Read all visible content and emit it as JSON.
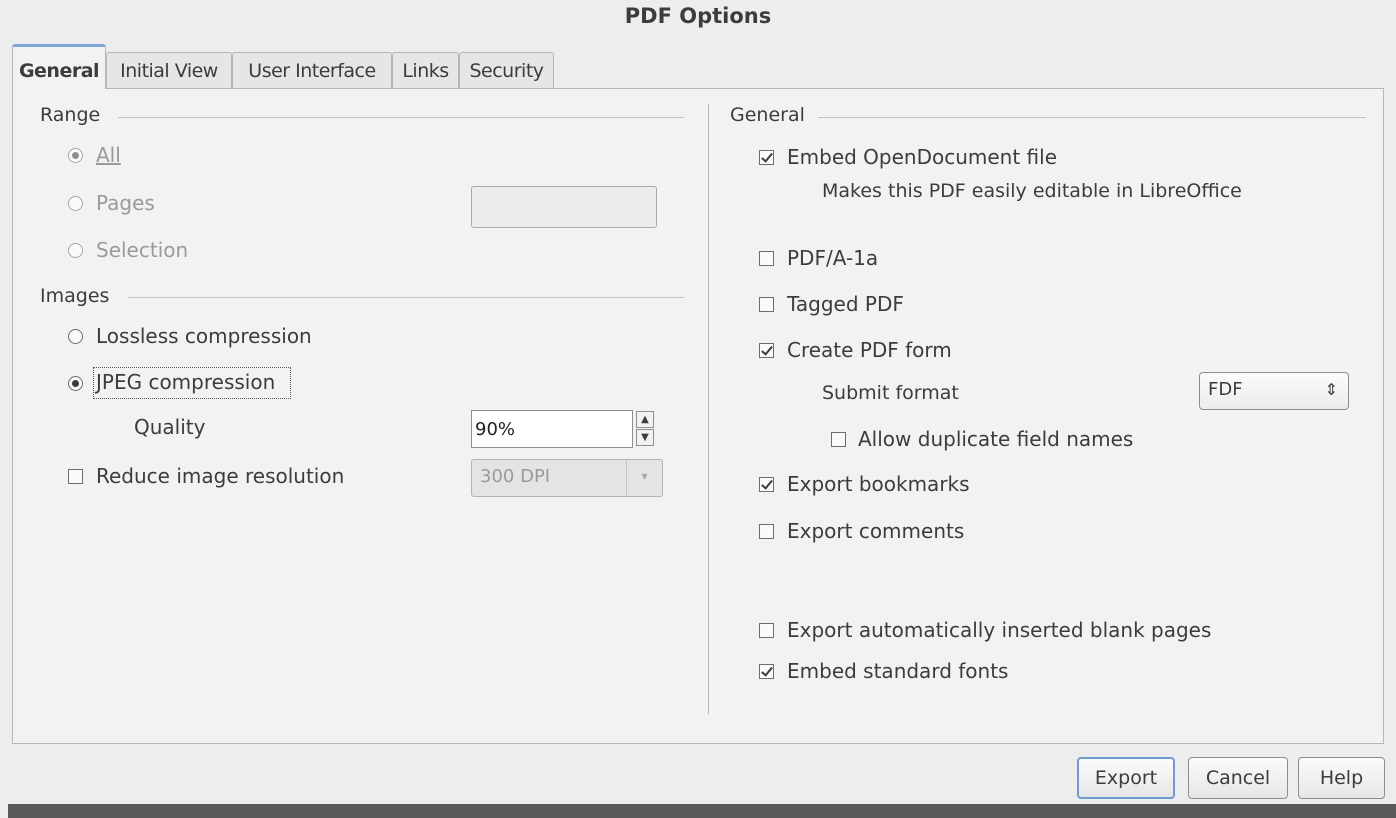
{
  "window": {
    "title": "PDF Options"
  },
  "tabs": [
    {
      "label": "General",
      "active": true
    },
    {
      "label": "Initial View",
      "active": false
    },
    {
      "label": "User Interface",
      "active": false
    },
    {
      "label": "Links",
      "active": false
    },
    {
      "label": "Security",
      "active": false
    }
  ],
  "range": {
    "section_label": "Range",
    "all_label": "All",
    "pages_label": "Pages",
    "pages_value": "",
    "selection_label": "Selection",
    "selected": "All"
  },
  "images": {
    "section_label": "Images",
    "lossless_label": "Lossless compression",
    "jpeg_label": "JPEG compression",
    "selected": "JPEG compression",
    "quality_label": "Quality",
    "quality_value": "90%",
    "reduce_label": "Reduce image resolution",
    "reduce_checked": false,
    "resolution_value": "300 DPI"
  },
  "general": {
    "section_label": "General",
    "embed_odf_label": "Embed OpenDocument file",
    "embed_odf_checked": true,
    "embed_odf_hint": "Makes this PDF easily editable in LibreOffice",
    "pdfa_label": "PDF/A-1a",
    "pdfa_checked": false,
    "tagged_label": "Tagged PDF",
    "tagged_checked": false,
    "form_label": "Create PDF form",
    "form_checked": true,
    "submit_format_label": "Submit format",
    "submit_format_value": "FDF",
    "duplicate_label": "Allow duplicate field names",
    "duplicate_checked": false,
    "bookmarks_label": "Export bookmarks",
    "bookmarks_checked": true,
    "comments_label": "Export comments",
    "comments_checked": false,
    "blank_pages_label": "Export automatically inserted blank pages",
    "blank_pages_checked": false,
    "std_fonts_label": "Embed standard fonts",
    "std_fonts_checked": true
  },
  "buttons": {
    "export_label": "Export",
    "cancel_label": "Cancel",
    "help_label": "Help"
  }
}
